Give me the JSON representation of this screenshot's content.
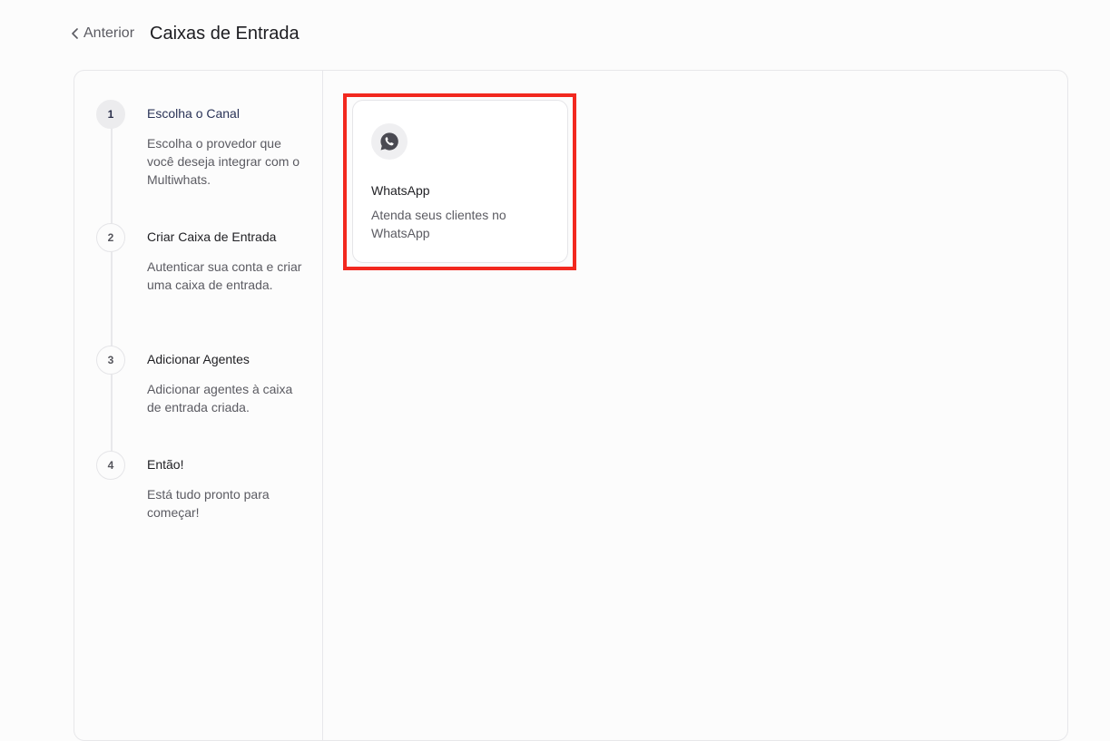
{
  "header": {
    "back_label": "Anterior",
    "title": "Caixas de Entrada"
  },
  "steps": [
    {
      "number": "1",
      "title": "Escolha o Canal",
      "description": "Escolha o provedor que você deseja integrar com o Multiwhats.",
      "active": true
    },
    {
      "number": "2",
      "title": "Criar Caixa de Entrada",
      "description": "Autenticar sua conta e criar uma caixa de entrada.",
      "active": false
    },
    {
      "number": "3",
      "title": "Adicionar Agentes",
      "description": "Adicionar agentes à caixa de entrada criada.",
      "active": false
    },
    {
      "number": "4",
      "title": "Então!",
      "description": "Está tudo pronto para começar!",
      "active": false
    }
  ],
  "channels": [
    {
      "icon": "whatsapp-icon",
      "title": "WhatsApp",
      "description": "Atenda seus clientes no WhatsApp"
    }
  ],
  "colors": {
    "highlight": "#f2281f",
    "active_step": "#2a3357"
  }
}
